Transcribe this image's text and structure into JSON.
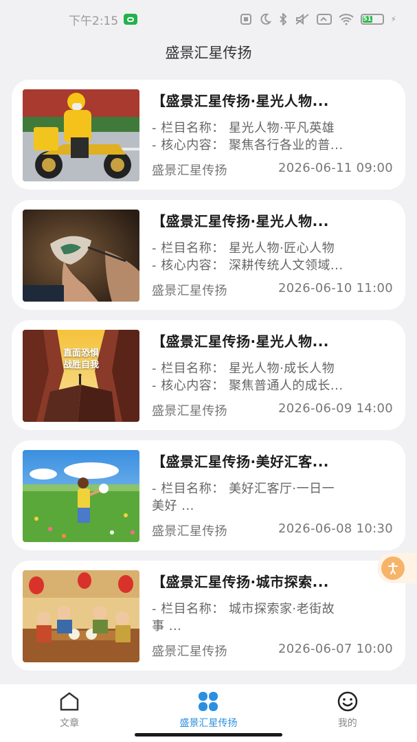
{
  "status_bar": {
    "time": "下午2:15",
    "battery": "51"
  },
  "header": {
    "title": "盛景汇星传扬"
  },
  "articles": [
    {
      "title": "【盛景汇星传扬·星光人物...",
      "line1": "- 栏目名称： 星光人物·平凡英雄",
      "line2": "- 核心内容： 聚焦各行各业的普...",
      "source": "盛景汇星传扬",
      "date": "2026-06-11 09:00"
    },
    {
      "title": "【盛景汇星传扬·星光人物...",
      "line1": "- 栏目名称： 星光人物·匠心人物",
      "line2": "- 核心内容： 深耕传统人文领域...",
      "source": "盛景汇星传扬",
      "date": "2026-06-10 11:00"
    },
    {
      "title": "【盛景汇星传扬·星光人物...",
      "line1": "- 栏目名称： 星光人物·成长人物",
      "line2": "- 核心内容： 聚焦普通人的成长...",
      "source": "盛景汇星传扬",
      "date": "2026-06-09 14:00",
      "thumb_text_1": "直面恐惧",
      "thumb_text_2": "战胜自我"
    },
    {
      "title": "【盛景汇星传扬·美好汇客...",
      "line1": "- 栏目名称： 美好汇客厅·一日一",
      "line2": "美好 ...",
      "source": "盛景汇星传扬",
      "date": "2026-06-08 10:30"
    },
    {
      "title": "【盛景汇星传扬·城市探索...",
      "line1": "- 栏目名称： 城市探索家·老街故",
      "line2": "事 ...",
      "source": "盛景汇星传扬",
      "date": "2026-06-07 10:00"
    }
  ],
  "tabs": [
    {
      "label": "文章",
      "icon": "home-icon"
    },
    {
      "label": "盛景汇星传扬",
      "icon": "grid-icon"
    },
    {
      "label": "我的",
      "icon": "smile-icon"
    }
  ],
  "colors": {
    "accent": "#2a8fe0",
    "float_button": "#f6b46a"
  }
}
